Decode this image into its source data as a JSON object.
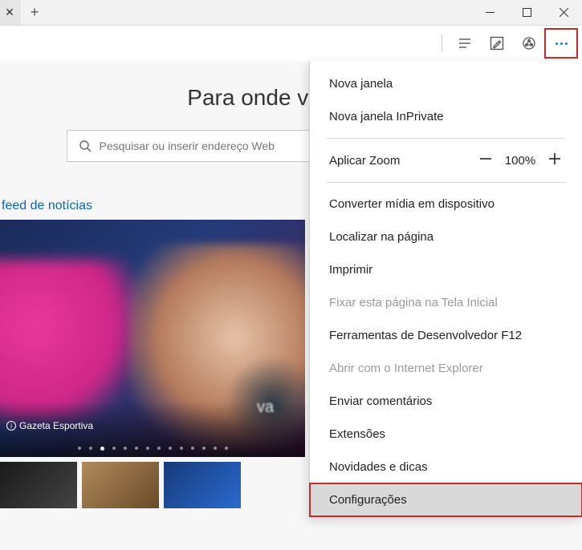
{
  "window": {
    "minimize": "—",
    "maximize": "☐",
    "close": "✕"
  },
  "page": {
    "heading": "Para onde vamos ag",
    "search_placeholder": "Pesquisar ou inserir endereço Web",
    "feed_label": "feed de notícias",
    "hero_caption": "Gazeta Esportiva",
    "hero_text_fragment": "va"
  },
  "menu": {
    "new_window": "Nova janela",
    "new_inprivate": "Nova janela InPrivate",
    "zoom_label": "Aplicar Zoom",
    "zoom_pct": "100%",
    "cast": "Converter mídia em dispositivo",
    "find": "Localizar na página",
    "print": "Imprimir",
    "pin": "Fixar esta página na Tela Inicial",
    "devtools": "Ferramentas de Desenvolvedor F12",
    "open_ie": "Abrir com o Internet Explorer",
    "feedback": "Enviar comentários",
    "extensions": "Extensões",
    "whatsnew": "Novidades e dicas",
    "settings": "Configurações"
  }
}
